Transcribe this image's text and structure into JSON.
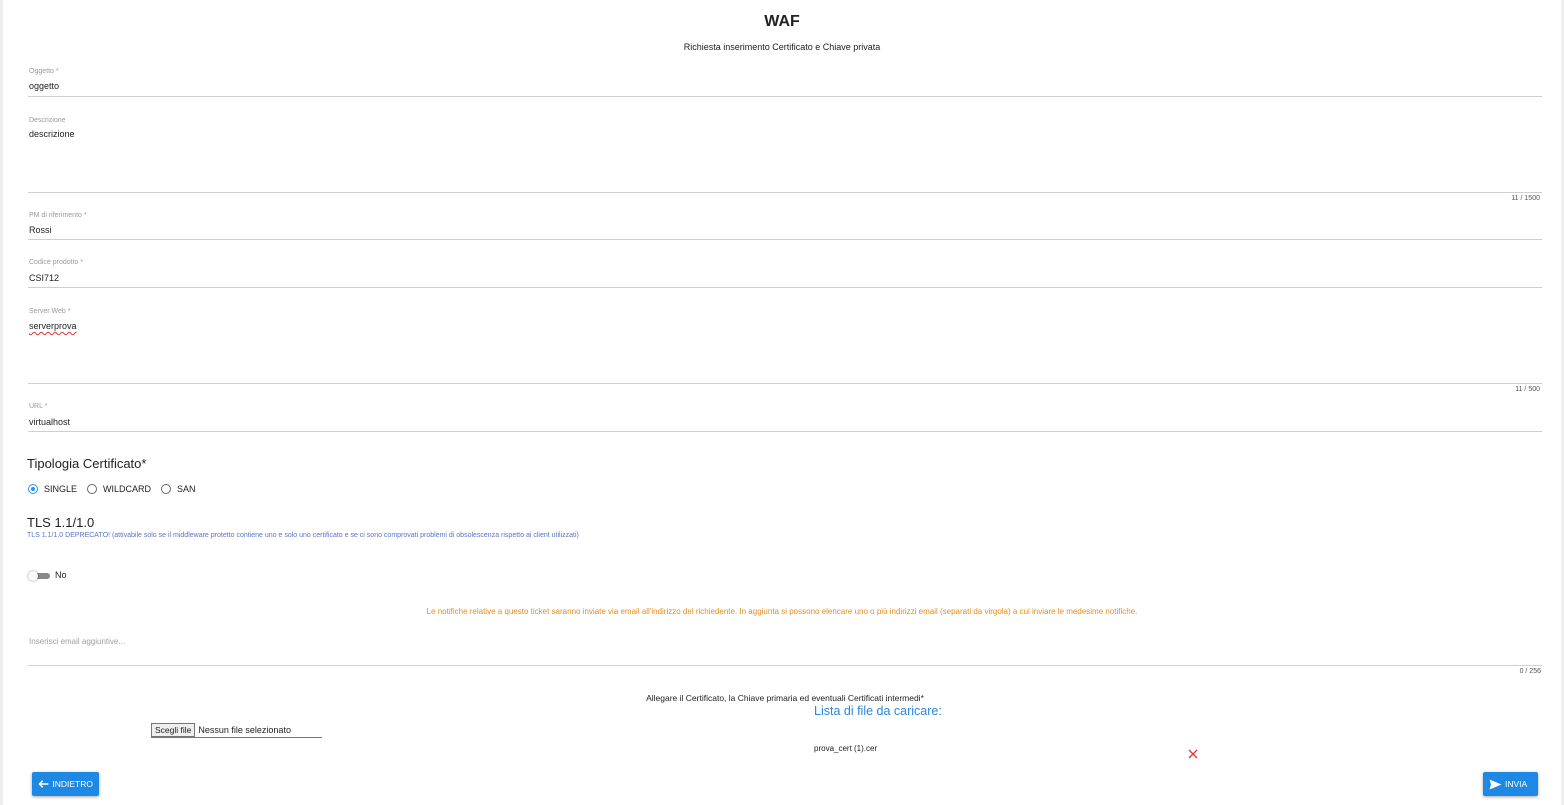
{
  "header": {
    "title": "WAF",
    "subtitle": "Richiesta inserimento Certificato e Chiave privata"
  },
  "form": {
    "oggetto": {
      "label": "Oggetto *",
      "value": "oggetto"
    },
    "descrizione": {
      "label": "Descrizione",
      "value": "descrizione",
      "counter": "11 / 1500"
    },
    "pm": {
      "label": "PM di riferimento *",
      "value": "Rossi"
    },
    "codice": {
      "label": "Codice prodotto *",
      "value": "CSI712"
    },
    "server": {
      "label": "Server Web *",
      "value": "serverprova",
      "counter": "11 / 500"
    },
    "url": {
      "label": "URL *",
      "value": "virtualhost"
    }
  },
  "cert_type": {
    "title": "Tipologia Certificato*",
    "options": [
      "SINGLE",
      "WILDCARD",
      "SAN"
    ],
    "selected": "SINGLE"
  },
  "tls": {
    "title": "TLS 1.1/1.0",
    "note": "TLS 1.1/1.0 DEPRECATO! (attivabile solo se il middleware protetto contiene uno e solo uno certificato e se ci sono comprovati problemi di obsolescenza rispetto ai client utilizzati)",
    "toggle_label": "No",
    "enabled": false
  },
  "notify": {
    "notice": "Le notifiche relative a questo ticket saranno inviate via email all'indirizzo del richiedente. In aggiunta si possono elencare uno o più indirizzi email (separati da virgola) a cui inviare le medesime notifiche.",
    "placeholder": "Inserisci email aggiuntive...",
    "counter": "0 / 256"
  },
  "attachments": {
    "title": "Allegare il Certificato, la Chiave primaria ed eventuali Certificati intermedi*",
    "choose_label": "Scegli file",
    "no_file": "Nessun file selezionato",
    "list_title": "Lista di file da caricare:",
    "files": [
      "prova_cert (1).cer"
    ]
  },
  "actions": {
    "back_label": "INDIETRO",
    "send_label": "INVIA"
  },
  "colors": {
    "accent": "#1e88e5",
    "notice": "#e78c1b",
    "note": "#5b74c4",
    "delete": "#e53935"
  }
}
